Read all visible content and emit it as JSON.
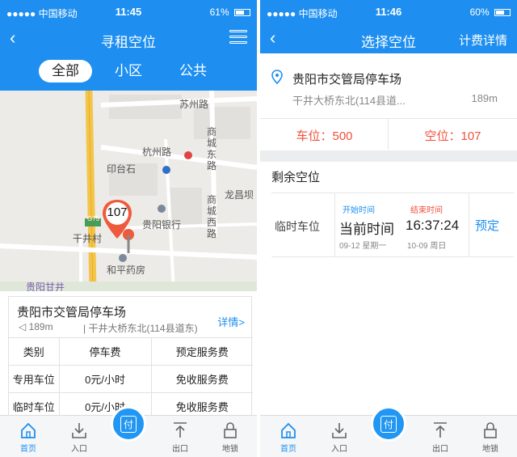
{
  "left": {
    "status": {
      "carrier": "●●●●● 中国移动",
      "time": "11:45",
      "battery": "61%",
      "battery_level": 0.61
    },
    "nav": {
      "title": "寻租空位"
    },
    "segments": [
      "全部",
      "小区",
      "公共"
    ],
    "map_labels": {
      "road1": "苏州路",
      "road2": "杭州路",
      "road3": "商城东路",
      "road4": "商城西路",
      "place1": "印台石",
      "place2": "龙昌坝",
      "bank": "贵阳银行",
      "village": "干井村",
      "pharmacy": "和平药房",
      "bottom": "贵阳甘井",
      "highway": "G75"
    },
    "marker_count": "107",
    "info": {
      "name": "贵阳市交管局停车场",
      "more": "详情>",
      "distance": "189m",
      "address": "干井大桥东北(114县道东)",
      "headers": [
        "类别",
        "停车费",
        "预定服务费"
      ],
      "rows": [
        [
          "专用车位",
          "0元/小时",
          "免收服务费"
        ],
        [
          "临时车位",
          "0元/小时",
          "免收服务费"
        ]
      ]
    }
  },
  "right": {
    "status": {
      "carrier": "●●●●● 中国移动",
      "time": "11:46",
      "battery": "60%",
      "battery_level": 0.6
    },
    "nav": {
      "title": "选择空位",
      "right": "计费详情"
    },
    "lot": {
      "name": "贵阳市交管局停车场",
      "address": "干井大桥东北(114县道...",
      "distance": "189m",
      "total": "车位：500",
      "free": "空位：107"
    },
    "remain_title": "剩余空位",
    "slot": {
      "type": "临时车位",
      "start_label": "开始时间",
      "start_value": "当前时间",
      "start_date": "09-12 星期一",
      "end_label": "结束时间",
      "end_value": "16:37:24",
      "end_date": "10-09 周日",
      "action": "预定"
    }
  },
  "tabbar": {
    "home": "首页",
    "entry": "入口",
    "pay": "付",
    "exit": "出口",
    "lock": "地锁"
  },
  "colors": {
    "brand": "#1e8ff0",
    "accent_red": "#f0503c"
  }
}
